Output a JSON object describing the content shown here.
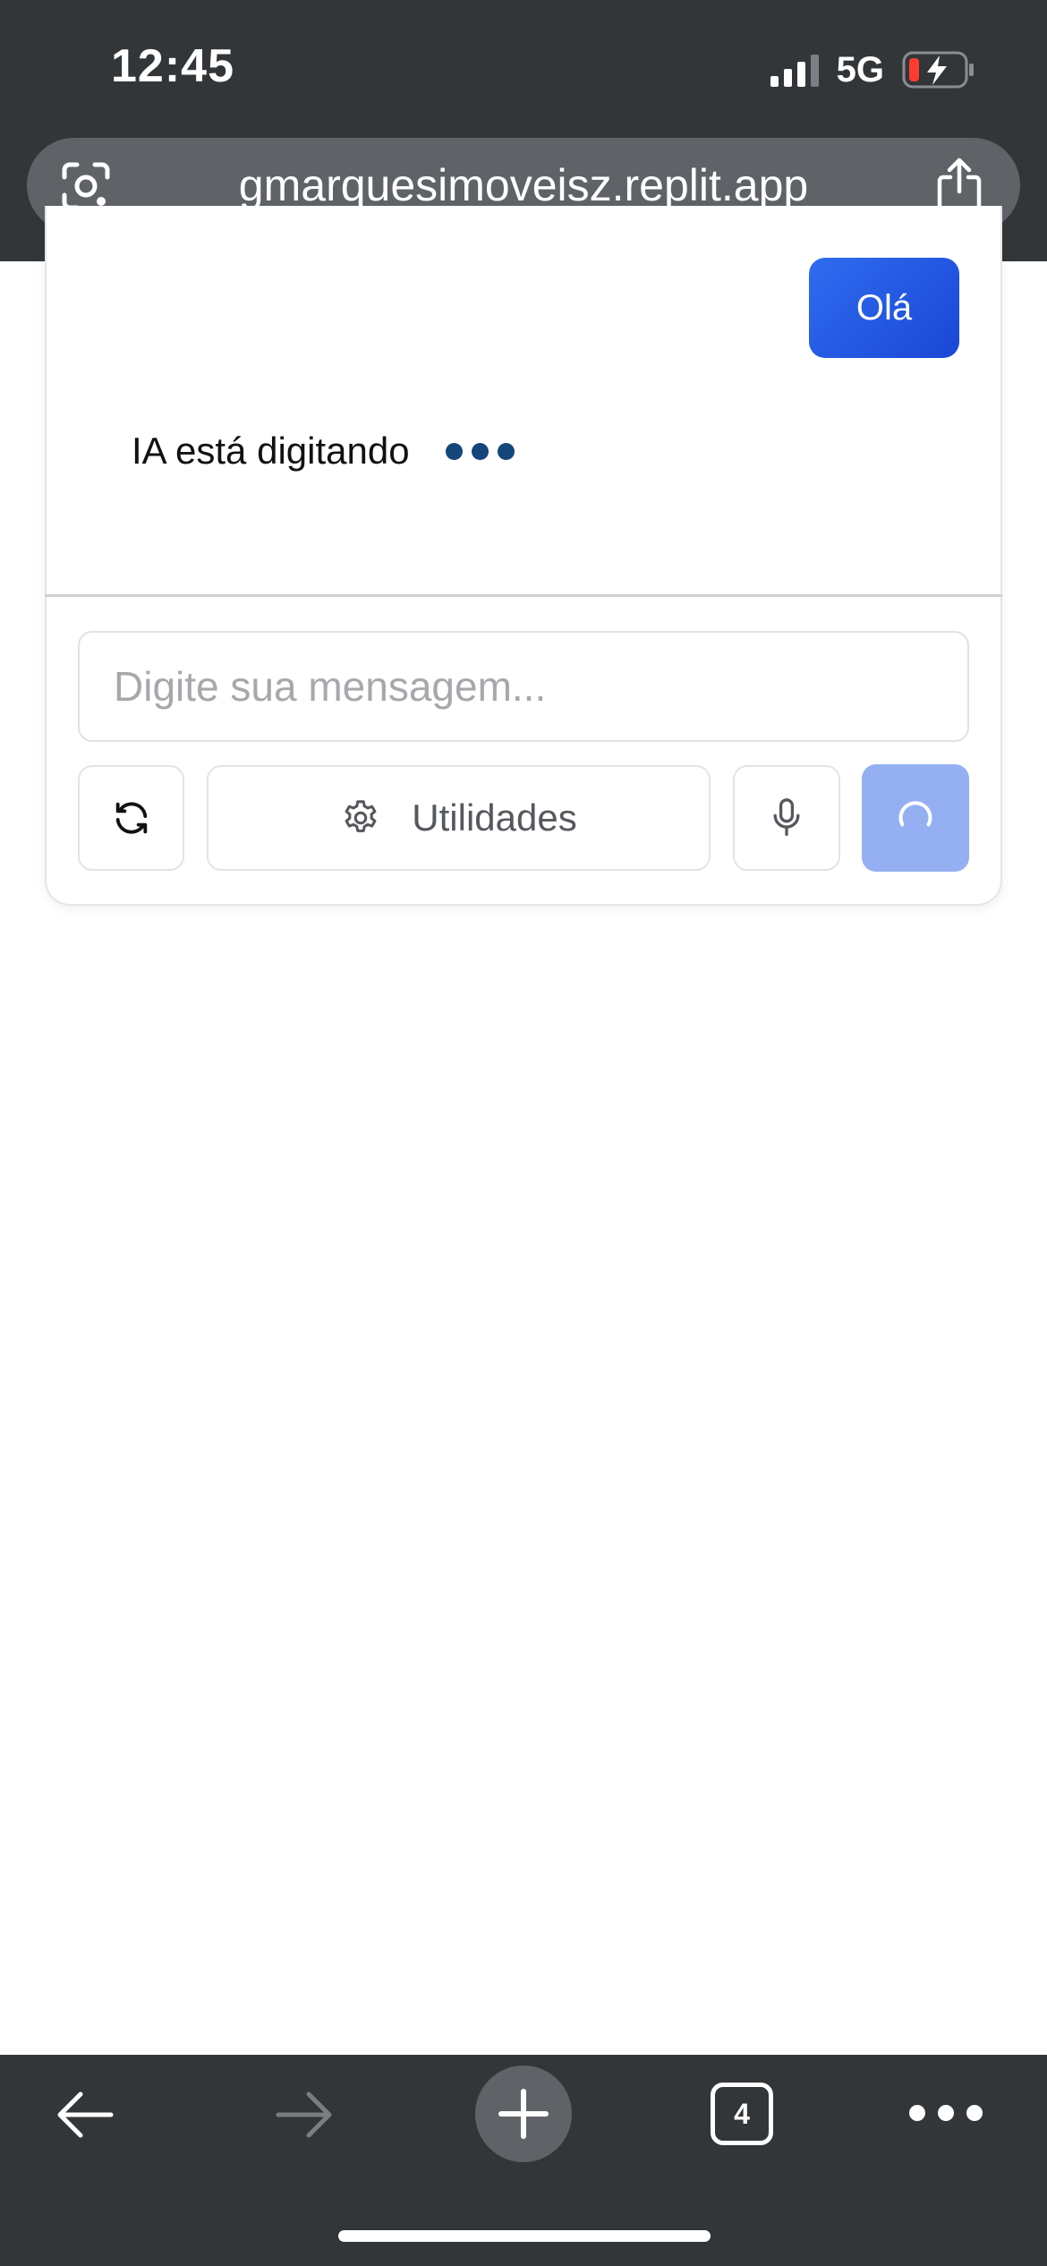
{
  "status_bar": {
    "time": "12:45",
    "network": "5G"
  },
  "browser": {
    "url": "gmarquesimoveisz.replit.app",
    "tab_count": "4"
  },
  "chat": {
    "user_message": "Olá",
    "typing_label": "IA está digitando",
    "input_placeholder": "Digite sua mensagem...",
    "utilities_label": "Utilidades"
  },
  "colors": {
    "chrome_background": "#333639",
    "user_bubble": "#2f6cf0",
    "typing_dots": "#14467a",
    "send_button_loading": "#94b0f3"
  },
  "icons": {
    "refresh": "refresh-icon",
    "settings": "gear-icon",
    "microphone": "microphone-icon",
    "send_state": "loading-spinner-icon",
    "lens": "lens-icon",
    "share": "share-icon"
  }
}
